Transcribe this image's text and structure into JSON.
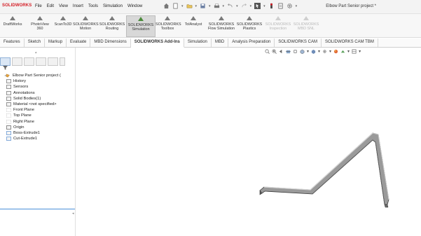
{
  "app": {
    "logo": "SOLIDWORKS",
    "doc_title": "Elbow Part Senior project *"
  },
  "menu": [
    "File",
    "Edit",
    "View",
    "Insert",
    "Tools",
    "Simulation",
    "Window"
  ],
  "ribbon": [
    {
      "l1": "DraftWorks",
      "l2": "",
      "active": false,
      "dim": false
    },
    {
      "l1": "PhotoView",
      "l2": "360",
      "active": false,
      "dim": false
    },
    {
      "l1": "ScanTo3D",
      "l2": "",
      "active": false,
      "dim": false
    },
    {
      "l1": "SOLIDWORKS",
      "l2": "Motion",
      "active": false,
      "dim": false
    },
    {
      "l1": "SOLIDWORKS",
      "l2": "Routing",
      "active": false,
      "dim": false
    },
    {
      "l1": "SOLIDWORKS",
      "l2": "Simulation",
      "active": true,
      "dim": false
    },
    {
      "l1": "SOLIDWORKS",
      "l2": "Toolbox",
      "active": false,
      "dim": false
    },
    {
      "l1": "TolAnalyst",
      "l2": "",
      "active": false,
      "dim": false
    },
    {
      "l1": "SOLIDWORKS",
      "l2": "Flow Simulation",
      "active": false,
      "dim": false
    },
    {
      "l1": "SOLIDWORKS",
      "l2": "Plastics",
      "active": false,
      "dim": false
    },
    {
      "l1": "SOLIDWORKS",
      "l2": "Inspection",
      "active": false,
      "dim": true
    },
    {
      "l1": "SOLIDWORKS",
      "l2": "MBD SNL",
      "active": false,
      "dim": true
    }
  ],
  "tabs": [
    {
      "label": "Features",
      "active": false
    },
    {
      "label": "Sketch",
      "active": false
    },
    {
      "label": "Markup",
      "active": false
    },
    {
      "label": "Evaluate",
      "active": false
    },
    {
      "label": "MBD Dimensions",
      "active": false
    },
    {
      "label": "SOLIDWORKS Add-Ins",
      "active": true
    },
    {
      "label": "Simulation",
      "active": false
    },
    {
      "label": "MBD",
      "active": false
    },
    {
      "label": "Analysis Preparation",
      "active": false
    },
    {
      "label": "SOLIDWORKS CAM",
      "active": false
    },
    {
      "label": "SOLIDWORKS CAM TBM",
      "active": false
    }
  ],
  "tree": {
    "filter_icon": "filter-icon",
    "root": "Elbow Part Senior project (",
    "items": [
      {
        "label": "History",
        "icon": "history-icon"
      },
      {
        "label": "Sensors",
        "icon": "sensor-icon"
      },
      {
        "label": "Annotations",
        "icon": "annotation-icon"
      },
      {
        "label": "Solid Bodies(1)",
        "icon": "solid-bodies-icon"
      },
      {
        "label": "Material <not specified>",
        "icon": "material-icon"
      },
      {
        "label": "Front Plane",
        "icon": "plane-icon"
      },
      {
        "label": "Top Plane",
        "icon": "plane-icon"
      },
      {
        "label": "Right Plane",
        "icon": "plane-icon"
      },
      {
        "label": "Origin",
        "icon": "origin-icon"
      },
      {
        "label": "Boss-Extrude1",
        "icon": "boss-extrude-icon"
      },
      {
        "label": "Cut-Extrude1",
        "icon": "cut-extrude-icon"
      }
    ]
  },
  "colors": {
    "accent": "#d41d25",
    "selection": "#4a90d9",
    "part": "#8a8a8a"
  }
}
